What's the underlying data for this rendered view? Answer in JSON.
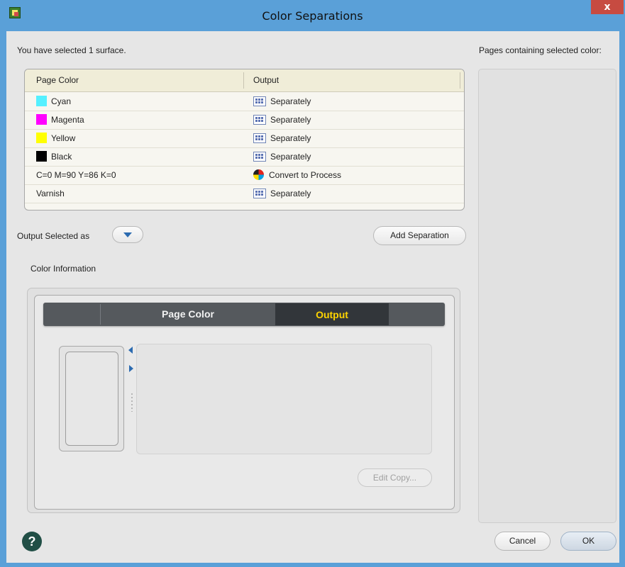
{
  "window": {
    "title": "Color Separations",
    "close_label": "x"
  },
  "selection_text": "You have selected 1 surface.",
  "pages_label": "Pages containing selected color:",
  "table": {
    "columns": [
      "Page Color",
      "Output"
    ],
    "rows": [
      {
        "name": "Cyan",
        "swatch": "#55f0ff",
        "output": "Separately",
        "output_icon": "separate-grid-icon"
      },
      {
        "name": "Magenta",
        "swatch": "#ff00ff",
        "output": "Separately",
        "output_icon": "separate-grid-icon"
      },
      {
        "name": "Yellow",
        "swatch": "#ffff00",
        "output": "Separately",
        "output_icon": "separate-grid-icon"
      },
      {
        "name": "Black",
        "swatch": "#000000",
        "output": "Separately",
        "output_icon": "separate-grid-icon"
      },
      {
        "name": "C=0 M=90 Y=86 K=0",
        "swatch": null,
        "output": "Convert to Process",
        "output_icon": "process-color-icon"
      },
      {
        "name": "Varnish",
        "swatch": null,
        "output": "Separately",
        "output_icon": "separate-grid-icon"
      }
    ]
  },
  "output_selected_label": "Output Selected as",
  "add_separation_label": "Add Separation",
  "color_information_label": "Color Information",
  "tabs": {
    "page_color": "Page Color",
    "output": "Output",
    "active": "Output"
  },
  "edit_copy_label": "Edit Copy...",
  "help_label": "?",
  "cancel_label": "Cancel",
  "ok_label": "OK",
  "colors": {
    "accent_blue": "#2c6bb0",
    "active_tab_text": "#ffd400",
    "titlebar": "#5aa0d8"
  }
}
